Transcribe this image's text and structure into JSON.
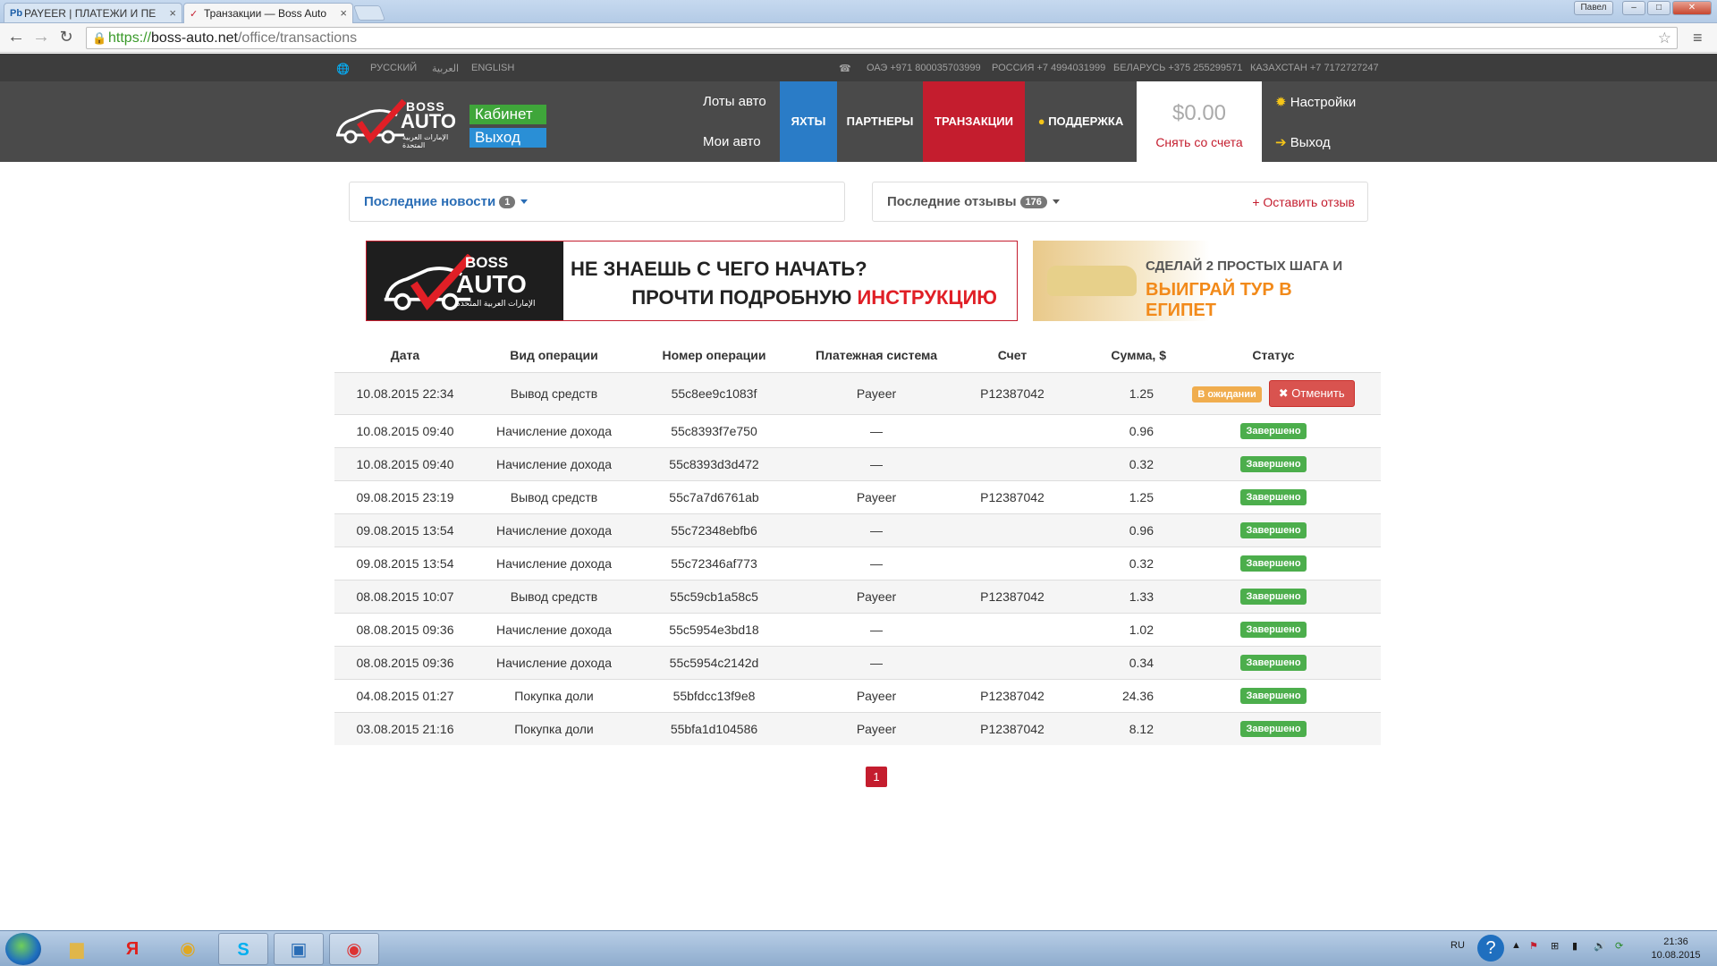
{
  "browser": {
    "tabs": [
      {
        "icon": "Pb",
        "title": "PAYEER | ПЛАТЕЖИ И ПЕ"
      },
      {
        "icon": "✓",
        "title": "Транзакции — Boss Auto"
      }
    ],
    "window_user": "Павел",
    "url": {
      "scheme": "https://",
      "host": "boss-auto.net",
      "path": "/office/transactions"
    }
  },
  "topbar": {
    "languages": [
      "РУССКИЙ",
      "العربية",
      "ENGLISH"
    ],
    "phones": [
      "ОАЭ +971 800035703999",
      "РОССИЯ +7 4994031999",
      "БЕЛАРУСЬ +375 255299571",
      "КАЗАХСТАН +7 7172727247"
    ]
  },
  "header": {
    "logo": {
      "boss": "BOSS",
      "auto": "AUTO",
      "tagline": "الإمارات العربية المتحدة"
    },
    "cabinet_label": "Кабинет",
    "exit_label": "Выход",
    "lots_label": "Лоты авто",
    "my_cars_label": "Мои авто",
    "nav": [
      {
        "label": "ЯХТЫ",
        "color": "#2a7cc7"
      },
      {
        "label": "ПАРТНЕРЫ",
        "color": "#4a4a4a"
      },
      {
        "label": "ТРАНЗАКЦИИ",
        "color": "#c41d2e"
      },
      {
        "label": "ПОДДЕРЖКА",
        "color": "#4a4a4a"
      }
    ],
    "balance": "$0.00",
    "withdraw_label": "Снять со счета",
    "settings_label": "Настройки",
    "logout_label": "Выход"
  },
  "panels": {
    "news": {
      "title": "Последние новости",
      "count": "1"
    },
    "reviews": {
      "title": "Последние отзывы",
      "count": "176",
      "leave_review": "+ Оставить отзыв"
    }
  },
  "banners": {
    "left": {
      "line1": "НЕ ЗНАЕШЬ С ЧЕГО НАЧАТЬ?",
      "line2": "ПРОЧТИ ПОДРОБНУЮ",
      "highlight": "ИНСТРУКЦИЮ"
    },
    "right": {
      "line1": "СДЕЛАЙ 2 ПРОСТЫХ ШАГА И",
      "line2": "ВЫИГРАЙ ТУР В ЕГИПЕТ"
    }
  },
  "table": {
    "headers": [
      "Дата",
      "Вид операции",
      "Номер операции",
      "Платежная система",
      "Счет",
      "Сумма, $",
      "Статус"
    ],
    "rows": [
      {
        "date": "10.08.2015 22:34",
        "type": "Вывод средств",
        "id": "55c8ee9c1083f",
        "system": "Payeer",
        "account": "P12387042",
        "amount": "1.25",
        "status": "В ожидании",
        "action": "Отменить"
      },
      {
        "date": "10.08.2015 09:40",
        "type": "Начисление дохода",
        "id": "55c8393f7e750",
        "system": "—",
        "account": "",
        "amount": "0.96",
        "status": "Завершено"
      },
      {
        "date": "10.08.2015 09:40",
        "type": "Начисление дохода",
        "id": "55c8393d3d472",
        "system": "—",
        "account": "",
        "amount": "0.32",
        "status": "Завершено"
      },
      {
        "date": "09.08.2015 23:19",
        "type": "Вывод средств",
        "id": "55c7a7d6761ab",
        "system": "Payeer",
        "account": "P12387042",
        "amount": "1.25",
        "status": "Завершено"
      },
      {
        "date": "09.08.2015 13:54",
        "type": "Начисление дохода",
        "id": "55c72348ebfb6",
        "system": "—",
        "account": "",
        "amount": "0.96",
        "status": "Завершено"
      },
      {
        "date": "09.08.2015 13:54",
        "type": "Начисление дохода",
        "id": "55c72346af773",
        "system": "—",
        "account": "",
        "amount": "0.32",
        "status": "Завершено"
      },
      {
        "date": "08.08.2015 10:07",
        "type": "Вывод средств",
        "id": "55c59cb1a58c5",
        "system": "Payeer",
        "account": "P12387042",
        "amount": "1.33",
        "status": "Завершено"
      },
      {
        "date": "08.08.2015 09:36",
        "type": "Начисление дохода",
        "id": "55c5954e3bd18",
        "system": "—",
        "account": "",
        "amount": "1.02",
        "status": "Завершено"
      },
      {
        "date": "08.08.2015 09:36",
        "type": "Начисление дохода",
        "id": "55c5954c2142d",
        "system": "—",
        "account": "",
        "amount": "0.34",
        "status": "Завершено"
      },
      {
        "date": "04.08.2015 01:27",
        "type": "Покупка доли",
        "id": "55bfdcc13f9e8",
        "system": "Payeer",
        "account": "P12387042",
        "amount": "24.36",
        "status": "Завершено"
      },
      {
        "date": "03.08.2015 21:16",
        "type": "Покупка доли",
        "id": "55bfa1d104586",
        "system": "Payeer",
        "account": "P12387042",
        "amount": "8.12",
        "status": "Завершено"
      }
    ]
  },
  "pagination": {
    "current": "1"
  },
  "taskbar": {
    "yandex_label": "Я",
    "lang": "RU",
    "time": "21:36",
    "date": "10.08.2015"
  }
}
